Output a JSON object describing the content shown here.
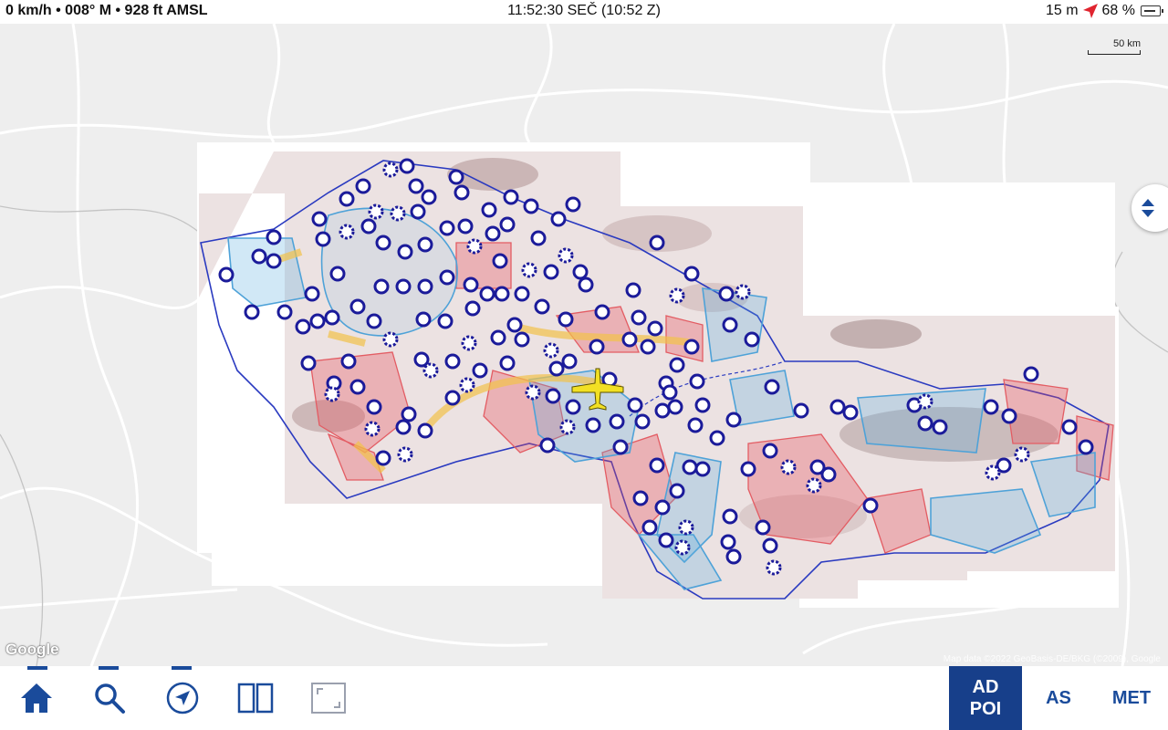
{
  "status": {
    "left": "0 km/h • 008° M • 928 ft AMSL",
    "center": "11:52:30 SEČ (10:52 Z)",
    "gps_accuracy": "15 m",
    "battery": "68 %"
  },
  "map": {
    "scale_label": "50 km",
    "provider_logo": "Google",
    "attribution": "Map data ©2022 GeoBasis-DE/BKG (©2009), Google"
  },
  "toolbar": {
    "home_icon": "home-icon",
    "search_icon": "search-icon",
    "navigate_icon": "navigation-arrow-icon",
    "split_icon": "split-view-icon",
    "fullscreen_icon": "fullscreen-icon",
    "tabs": [
      {
        "line1": "AD",
        "line2": "POI",
        "active": true
      },
      {
        "line1": "AS",
        "line2": "",
        "active": false
      },
      {
        "line1": "MET",
        "line2": "",
        "active": false
      }
    ]
  },
  "colors": {
    "accent": "#1a4b9b",
    "active_tab": "#173f8a",
    "airport_marker": "#1b1b9a",
    "restricted_area": "#e8505b",
    "controlled_airspace": "#5aaee0",
    "aircraft": "#f2e024"
  }
}
